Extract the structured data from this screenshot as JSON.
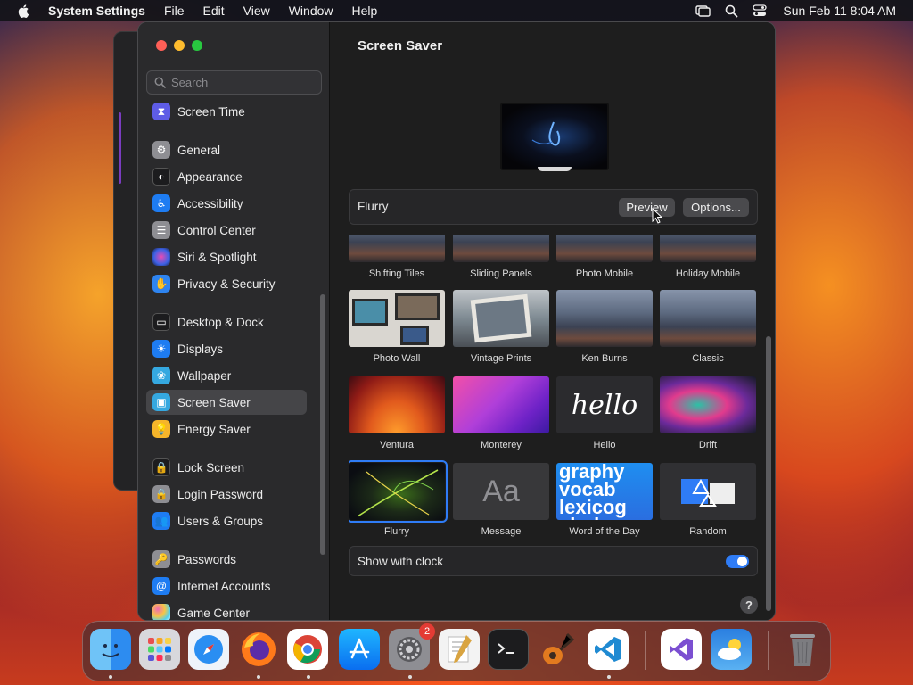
{
  "menubar": {
    "app_name": "System Settings",
    "menus": [
      "File",
      "Edit",
      "View",
      "Window",
      "Help"
    ],
    "clock": "Sun Feb 11  8:04 AM"
  },
  "sidebar": {
    "search_placeholder": "Search",
    "items": [
      {
        "label": "Screen Time",
        "icon": "hourglass-icon",
        "color": "#5e5ce6"
      },
      {
        "label": "General",
        "icon": "gear-icon",
        "color": "#8e8e93"
      },
      {
        "label": "Appearance",
        "icon": "appearance-icon",
        "color": "#1c1c1e"
      },
      {
        "label": "Accessibility",
        "icon": "accessibility-icon",
        "color": "#1e7cf2"
      },
      {
        "label": "Control Center",
        "icon": "control-center-icon",
        "color": "#8e8e93"
      },
      {
        "label": "Siri & Spotlight",
        "icon": "siri-icon",
        "color": "#3b3b7a"
      },
      {
        "label": "Privacy & Security",
        "icon": "hand-icon",
        "color": "#2e84f0"
      },
      {
        "label": "Desktop & Dock",
        "icon": "desktop-icon",
        "color": "#1c1c1e"
      },
      {
        "label": "Displays",
        "icon": "sun-icon",
        "color": "#1e7cf2"
      },
      {
        "label": "Wallpaper",
        "icon": "flower-icon",
        "color": "#35a8e0"
      },
      {
        "label": "Screen Saver",
        "icon": "screen-saver-icon",
        "color": "#35a8e0"
      },
      {
        "label": "Energy Saver",
        "icon": "battery-icon",
        "color": "#f5b52a"
      },
      {
        "label": "Lock Screen",
        "icon": "lock-icon",
        "color": "#1c1c1e"
      },
      {
        "label": "Login Password",
        "icon": "padlock-icon",
        "color": "#8e8e93"
      },
      {
        "label": "Users & Groups",
        "icon": "users-icon",
        "color": "#1e7cf2"
      },
      {
        "label": "Passwords",
        "icon": "key-icon",
        "color": "#8e8e93"
      },
      {
        "label": "Internet Accounts",
        "icon": "at-icon",
        "color": "#1e7cf2"
      },
      {
        "label": "Game Center",
        "icon": "game-center-icon",
        "color": "#ffffff"
      }
    ],
    "selected": "Screen Saver"
  },
  "content": {
    "title": "Screen Saver",
    "current_saver": "Flurry",
    "preview_button": "Preview",
    "options_button": "Options...",
    "savers": [
      {
        "label": "Shifting Tiles",
        "style": "mountain"
      },
      {
        "label": "Sliding Panels",
        "style": "mountain"
      },
      {
        "label": "Photo Mobile",
        "style": "mountain"
      },
      {
        "label": "Holiday Mobile",
        "style": "mountain"
      },
      {
        "label": "Photo Wall",
        "style": "photowall"
      },
      {
        "label": "Vintage Prints",
        "style": "mountain"
      },
      {
        "label": "Ken Burns",
        "style": "mountain"
      },
      {
        "label": "Classic",
        "style": "mountain"
      },
      {
        "label": "Ventura",
        "style": "ventura"
      },
      {
        "label": "Monterey",
        "style": "monterey"
      },
      {
        "label": "Hello",
        "style": "hello"
      },
      {
        "label": "Drift",
        "style": "drift"
      },
      {
        "label": "Flurry",
        "style": "flurry"
      },
      {
        "label": "Message",
        "style": "message"
      },
      {
        "label": "Word of the Day",
        "style": "word"
      },
      {
        "label": "Random",
        "style": "random"
      }
    ],
    "hello_text": "hello",
    "message_text": "Aa",
    "word_text": "graphy vocab lexicog abulary",
    "show_with_clock_label": "Show with clock",
    "show_with_clock": true,
    "help": "?"
  },
  "dock": {
    "apps": [
      {
        "name": "finder",
        "color": "#2d8cf0",
        "running": true
      },
      {
        "name": "launchpad",
        "color": "#d8d8dc",
        "running": false
      },
      {
        "name": "safari",
        "color": "#e9f1fb",
        "running": false
      },
      {
        "name": "firefox",
        "color": "#3a1d6b",
        "running": true
      },
      {
        "name": "chrome",
        "color": "#ffffff",
        "running": true
      },
      {
        "name": "app-store",
        "color": "#1c8cf3",
        "running": false
      },
      {
        "name": "system-settings",
        "color": "#8e8e93",
        "running": true,
        "badge": "2"
      },
      {
        "name": "textedit",
        "color": "#f3f3f3",
        "running": false
      },
      {
        "name": "terminal",
        "color": "#1c1c1e",
        "running": false
      },
      {
        "name": "garageband",
        "color": "#2b2b2e",
        "running": false
      },
      {
        "name": "vscode",
        "color": "#ffffff",
        "running": true
      },
      {
        "name": "visual-studio",
        "color": "#ffffff",
        "running": false
      },
      {
        "name": "weather",
        "color": "#2a7fe0",
        "running": false
      },
      {
        "name": "trash",
        "color": "#6f6f73",
        "running": false
      }
    ]
  }
}
